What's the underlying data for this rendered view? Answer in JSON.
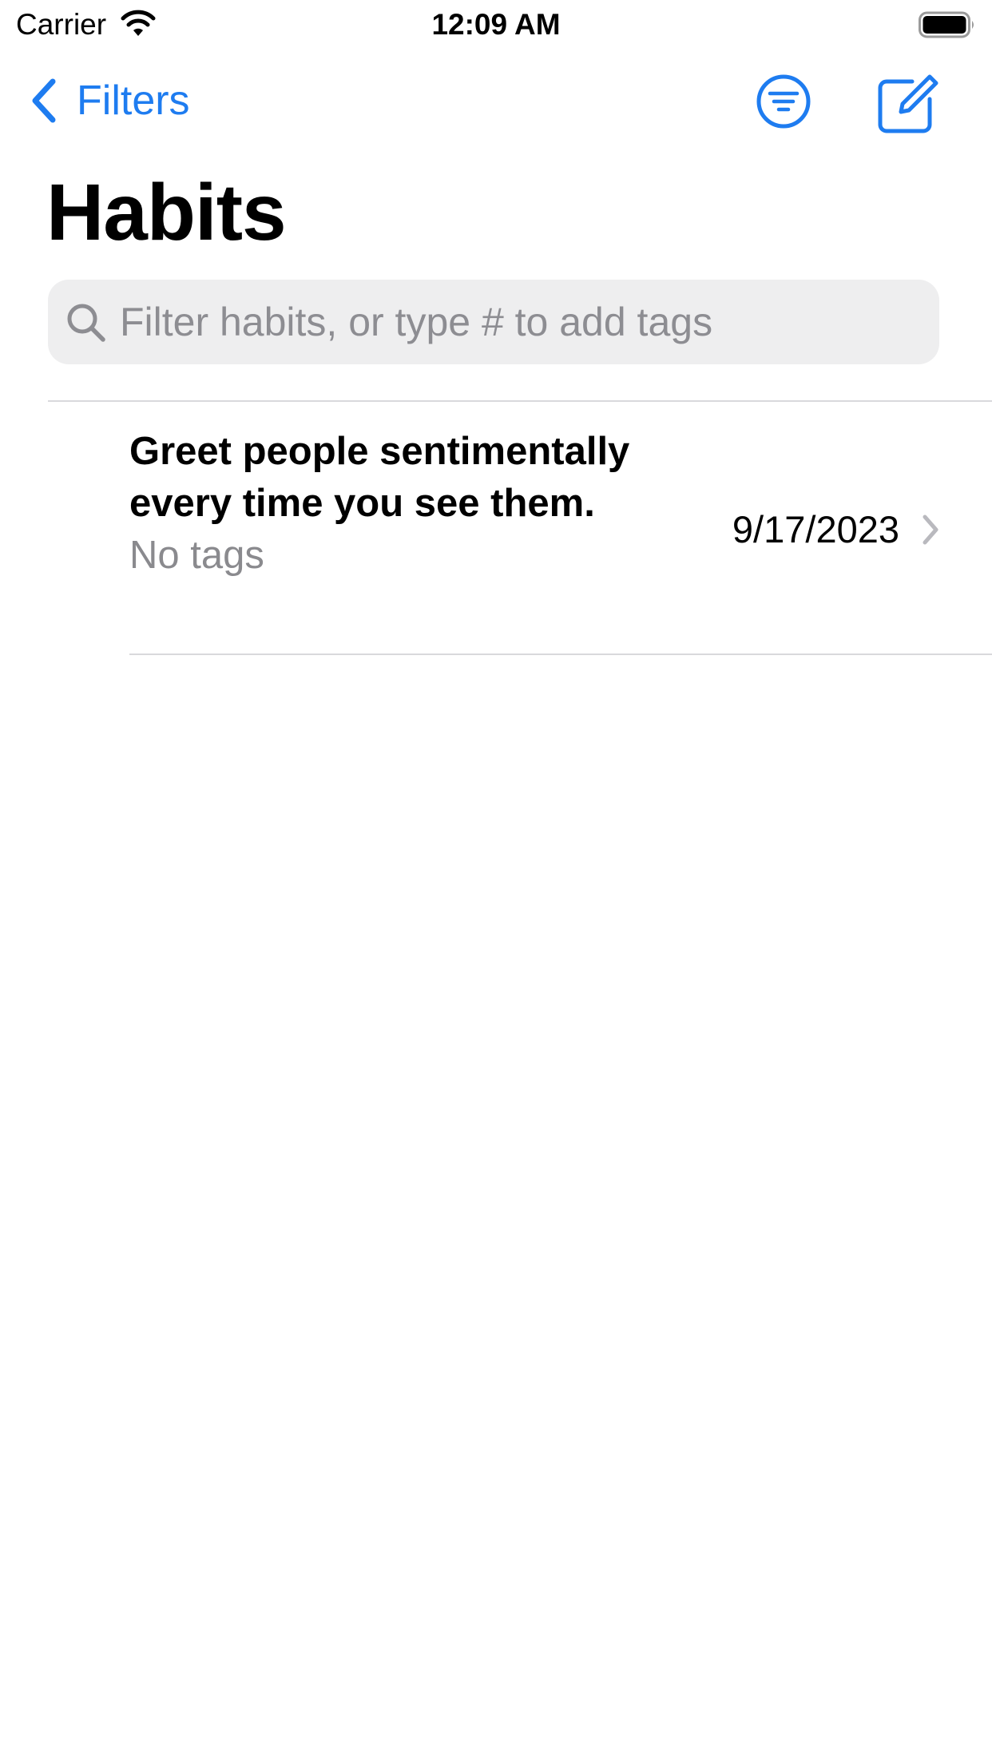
{
  "status_bar": {
    "carrier": "Carrier",
    "time": "12:09 AM",
    "wifi_icon": "wifi-icon",
    "battery_icon": "battery-full-icon"
  },
  "nav": {
    "back_label": "Filters",
    "back_icon": "chevron-left-icon",
    "filter_icon": "filter-circle-icon",
    "compose_icon": "compose-icon"
  },
  "page": {
    "title": "Habits"
  },
  "search": {
    "placeholder": "Filter habits, or type # to add tags",
    "value": "",
    "icon": "search-icon"
  },
  "habits": [
    {
      "title": "Greet people sentimentally every time you see them.",
      "tags": "No tags",
      "date": "9/17/2023"
    }
  ],
  "colors": {
    "accent": "#1e7cf0",
    "search_background": "#eeeeef",
    "secondary_text": "#8a8a8e",
    "separator": "#d9d9dc"
  }
}
